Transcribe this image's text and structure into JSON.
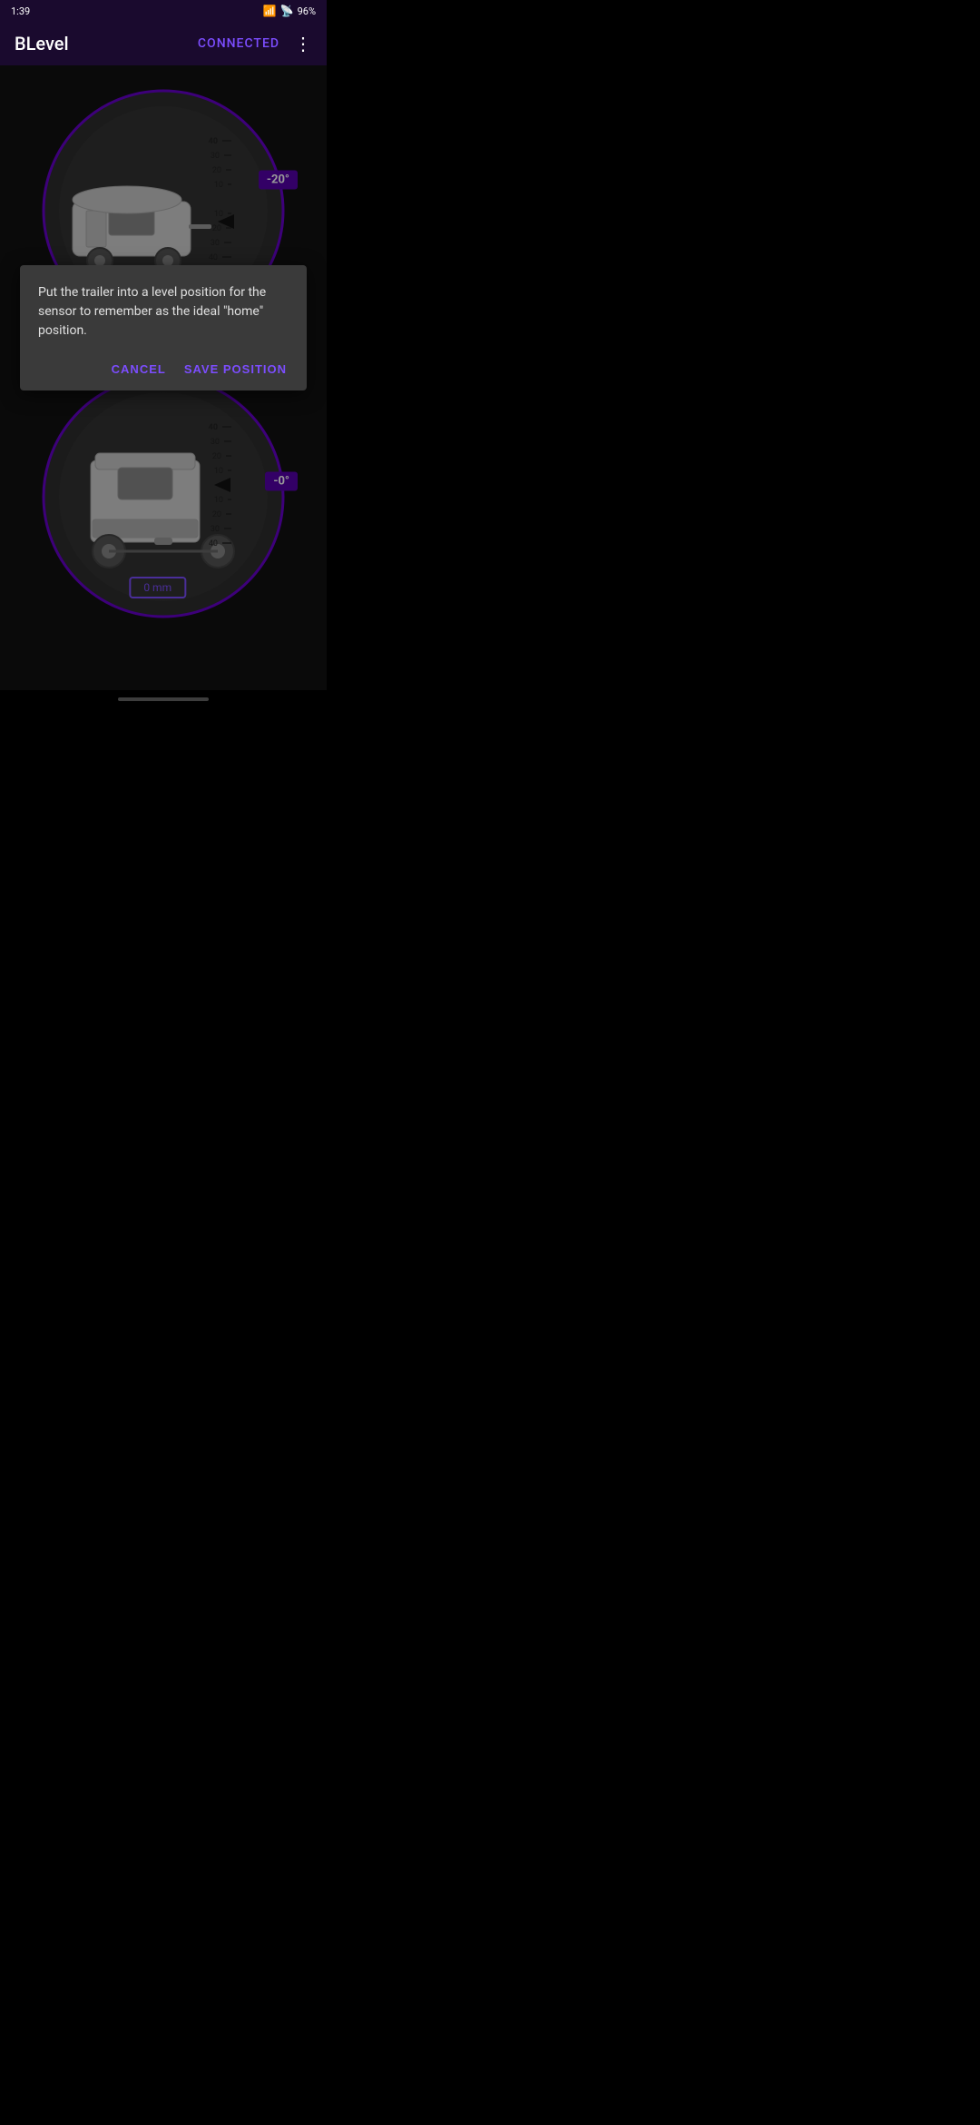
{
  "statusBar": {
    "time": "1:39",
    "battery": "96%"
  },
  "appBar": {
    "title": "BLevel",
    "connected": "CONNECTED",
    "menuIcon": "⋮"
  },
  "gaugeTop": {
    "angleBadge": "-20°",
    "scaleValues": [
      "40",
      "30",
      "20",
      "10",
      "0",
      "10",
      "20",
      "30",
      "40"
    ]
  },
  "gaugeBottom": {
    "angleBadge": "-0°",
    "mmBadge": "0 mm",
    "scaleValues": [
      "40",
      "30",
      "20",
      "10",
      "0",
      "10",
      "20",
      "30",
      "40"
    ]
  },
  "dialog": {
    "message": "Put the trailer into a level position for the sensor to remember as the ideal \"home\" position.",
    "cancelLabel": "CANCEL",
    "saveLabel": "SAVE POSITION"
  }
}
